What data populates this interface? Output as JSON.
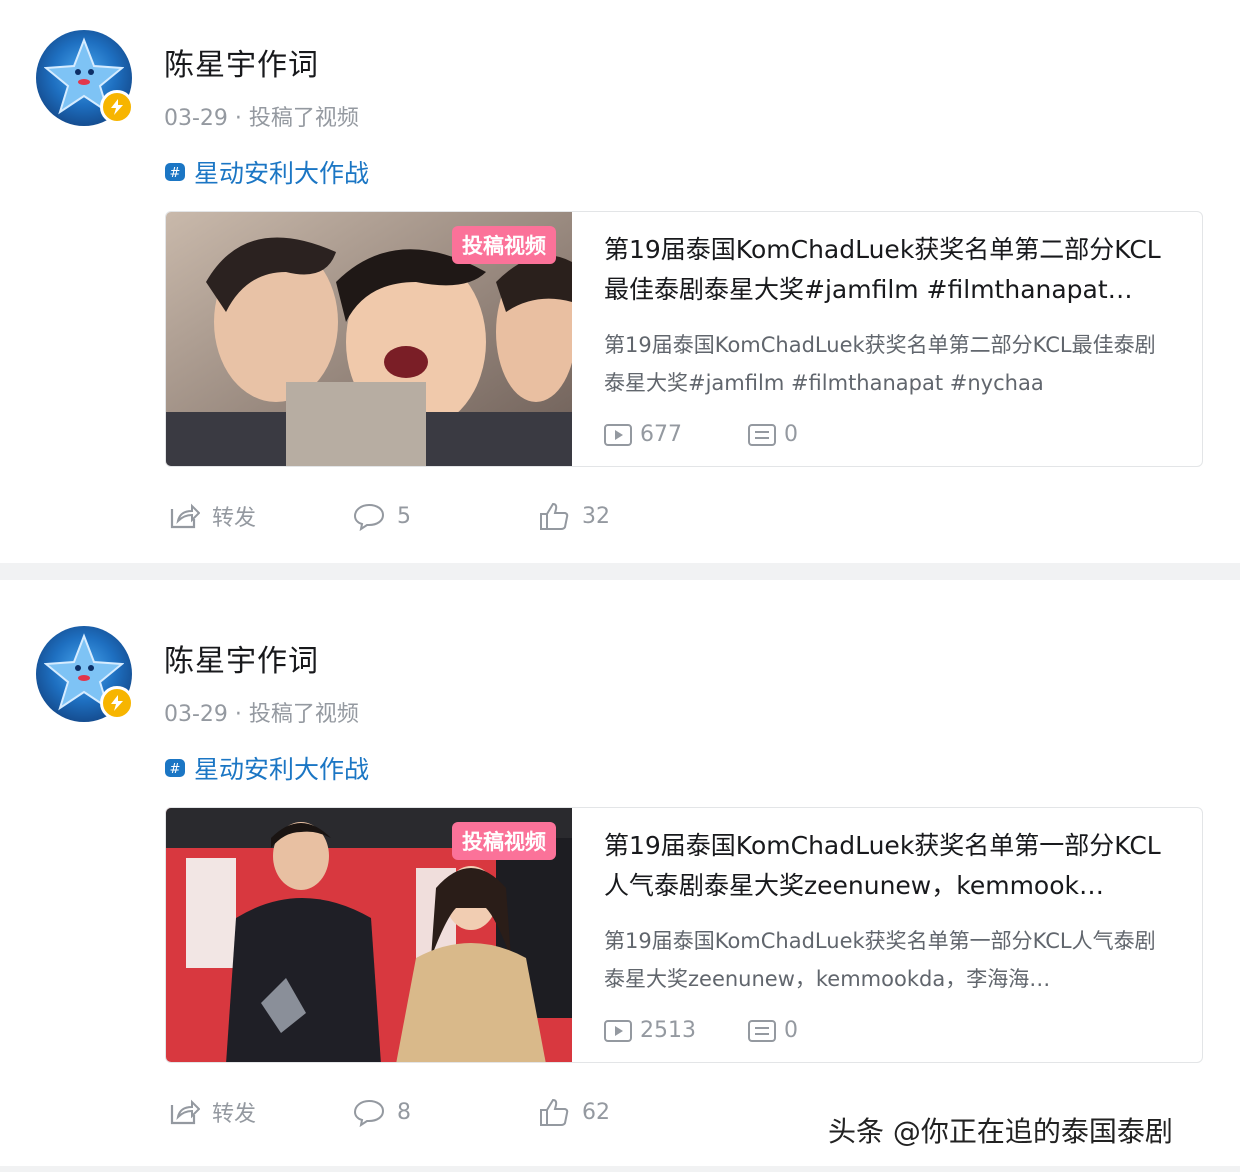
{
  "posts": [
    {
      "author": "陈星宇作词",
      "meta": "03-29 · 投稿了视频",
      "topic": "星动安利大作战",
      "card": {
        "tag": "投稿视频",
        "title": "第19届泰国KomChadLuek获奖名单第二部分KCL最佳泰剧泰星大奖#jamfilm #filmthanapat…",
        "desc": "第19届泰国KomChadLuek获奖名单第二部分KCL最佳泰剧泰星大奖#jamfilm #filmthanapat #nychaa",
        "views": "677",
        "danmaku": "0"
      },
      "actions": {
        "share": "转发",
        "comments": "5",
        "likes": "32"
      }
    },
    {
      "author": "陈星宇作词",
      "meta": "03-29 · 投稿了视频",
      "topic": "星动安利大作战",
      "card": {
        "tag": "投稿视频",
        "title": "第19届泰国KomChadLuek获奖名单第一部分KCL人气泰剧泰星大奖zeenunew，kemmook…",
        "desc": "第19届泰国KomChadLuek获奖名单第一部分KCL人气泰剧泰星大奖zeenunew，kemmookda，李海海…",
        "views": "2513",
        "danmaku": "0"
      },
      "actions": {
        "share": "转发",
        "comments": "8",
        "likes": "62"
      }
    }
  ],
  "watermark": "头条 @你正在追的泰国泰剧",
  "colors": {
    "link": "#1b76c4",
    "tag": "#fb7299",
    "muted": "#9499a0",
    "badge": "#f7b500"
  }
}
